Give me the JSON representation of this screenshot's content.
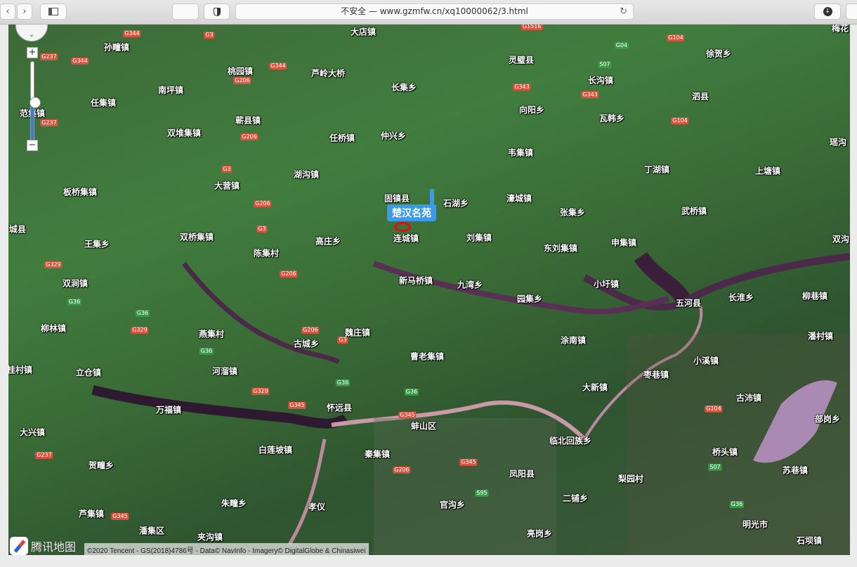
{
  "browser": {
    "address": "不安全 — www.gzmfw.cn/xq10000062/3.html",
    "back": "‹",
    "forward": "›"
  },
  "map": {
    "marker_label": "楚汉名苑",
    "zoom_in": "+",
    "zoom_out": "−",
    "zoom_level_fraction": 0.55,
    "logo_text": "腾讯地图",
    "attribution": "©2020 Tencent - GS(2018)4786号 - Data© NavInfo - Imagery© DigitalGlobe & Chinasiwei",
    "places": [
      "大店镇",
      "孙疃镇",
      "桃园镇",
      "芦岭大桥",
      "灵璧县",
      "徐贺乡",
      "南坪镇",
      "长集乡",
      "长沟镇",
      "任集镇",
      "向阳乡",
      "泗县",
      "范集镇",
      "蕲县镇",
      "瓦韩乡",
      "双堆集镇",
      "任桥镇",
      "仲兴乡",
      "韦集镇",
      "瑶沟",
      "湖沟镇",
      "丁湖镇",
      "上塘镇",
      "大营镇",
      "板桥集镇",
      "固镇县",
      "石湖乡",
      "濠城镇",
      "张集乡",
      "武桥镇",
      "城县",
      "双桥集镇",
      "高庄乡",
      "连城镇",
      "刘集镇",
      "王集乡",
      "申集镇",
      "陈集村",
      "东刘集镇",
      "双沟",
      "双涧镇",
      "新马桥镇",
      "九湾乡",
      "小圩镇",
      "园集乡",
      "五河县",
      "长淮乡",
      "柳巷镇",
      "柳林镇",
      "燕集村",
      "魏庄镇",
      "古城乡",
      "涂南镇",
      "潘村镇",
      "曹老集镇",
      "小溪镇",
      "桂村镇",
      "立仓镇",
      "河溜镇",
      "枣巷镇",
      "大新镇",
      "古沛镇",
      "万福镇",
      "怀远县",
      "蚌山区",
      "临北回族乡",
      "部岗乡",
      "大兴镇",
      "白莲坡镇",
      "秦集镇",
      "桥头镇",
      "贺疃乡",
      "凤阳县",
      "梨园村",
      "苏巷镇",
      "二铺乡",
      "朱疃乡",
      "孝仪",
      "官沟乡",
      "芦集镇",
      "潘集区",
      "夹沟镇",
      "亮岗乡",
      "明光市",
      "石坝镇",
      "梅花"
    ],
    "shields": [
      "G344",
      "G344",
      "G237",
      "G3",
      "G344",
      "G206",
      "G1516",
      "G104",
      "G04",
      "S07",
      "G343",
      "G343",
      "G104",
      "G206",
      "G3",
      "G237",
      "G206",
      "G3",
      "G206",
      "G329",
      "G36",
      "G36",
      "G329",
      "G206",
      "G3",
      "G36",
      "G329",
      "G345",
      "G36",
      "G36",
      "G345",
      "G206",
      "G345",
      "S95",
      "G104",
      "S07",
      "G36",
      "G237",
      "G345"
    ]
  }
}
